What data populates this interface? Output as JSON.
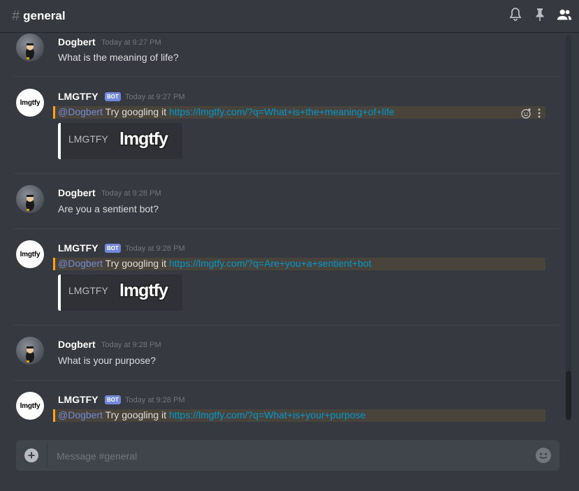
{
  "header": {
    "hash": "#",
    "channel": "general"
  },
  "messages": [
    {
      "author": "Dogbert",
      "time": "Today at 9:27 PM",
      "text": "What is the meaning of life?"
    },
    {
      "author": "LMGTFY",
      "bot_tag": "BOT",
      "time": "Today at 9:27 PM",
      "mention": "@Dogbert",
      "text": " Try googling it ",
      "link": "https://lmgtfy.com/?q=What+is+the+meaning+of+life",
      "embed_title": "LMGTFY",
      "embed_logo": "lmgtfy",
      "avatar_text": "lmgtfy"
    },
    {
      "author": "Dogbert",
      "time": "Today at 9:28 PM",
      "text": "Are you a sentient bot?"
    },
    {
      "author": "LMGTFY",
      "bot_tag": "BOT",
      "time": "Today at 9:28 PM",
      "mention": "@Dogbert",
      "text": " Try googling it ",
      "link": "https://lmgtfy.com/?q=Are+you+a+sentient+bot",
      "embed_title": "LMGTFY",
      "embed_logo": "lmgtfy",
      "avatar_text": "lmgtfy"
    },
    {
      "author": "Dogbert",
      "time": "Today at 9:28 PM",
      "text": "What is your purpose?"
    },
    {
      "author": "LMGTFY",
      "bot_tag": "BOT",
      "time": "Today at 9:28 PM",
      "mention": "@Dogbert",
      "text": " Try googling it ",
      "link": "https://lmgtfy.com/?q=What+is+your+purpose",
      "avatar_text": "lmgtfy"
    }
  ],
  "composer": {
    "plus": "+",
    "placeholder": "Message #general"
  },
  "icons": {
    "bell": "bell-icon",
    "pin": "pin-icon",
    "members": "members-icon",
    "emoji": "emoji-icon",
    "add_reaction": "add-reaction-icon",
    "more": "more-icon"
  },
  "colors": {
    "background": "#36393f",
    "mention_highlight": "#faa61a",
    "bot_tag": "#7289da",
    "link": "#0096cf"
  }
}
